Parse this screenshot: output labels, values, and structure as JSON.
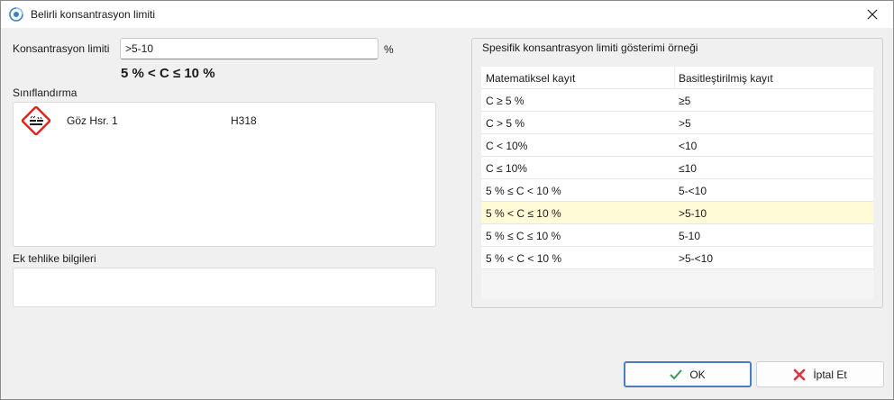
{
  "window": {
    "title": "Belirli konsantrasyon limiti"
  },
  "limit": {
    "label": "Konsantrasyon limiti",
    "value": ">5-10",
    "unit": "%",
    "formula": "5 % < C ≤ 10 %"
  },
  "classification": {
    "label": "Sınıflandırma",
    "items": [
      {
        "name": "Göz Hsr. 1",
        "code": "H318",
        "icon": "ghs05-corrosion-icon"
      }
    ]
  },
  "extra_hazard": {
    "label": "Ek tehlike bilgileri",
    "value": ""
  },
  "example": {
    "title": "Spesifik konsantrasyon limiti gösterimi örneği",
    "columns": [
      "Matematiksel kayıt",
      "Basitleştirilmiş kayıt"
    ],
    "rows": [
      [
        "C ≥ 5 %",
        "≥5"
      ],
      [
        "C > 5 %",
        ">5"
      ],
      [
        "C < 10%",
        "<10"
      ],
      [
        "C ≤ 10%",
        "≤10"
      ],
      [
        "5 % ≤ C < 10 %",
        "5-<10"
      ],
      [
        "5 % < C ≤ 10 %",
        ">5-10"
      ],
      [
        "5 % ≤ C ≤ 10 %",
        "5-10"
      ],
      [
        "5 % < C < 10 %",
        ">5-<10"
      ]
    ],
    "selected_index": 5
  },
  "buttons": {
    "ok": "OK",
    "cancel": "İptal Et"
  },
  "colors": {
    "accent": "#4a7fbf",
    "selected_row": "#fffbd6",
    "ok_check": "#3a9a5b",
    "cancel_x": "#d9363e",
    "ghs_red": "#e0201b"
  }
}
